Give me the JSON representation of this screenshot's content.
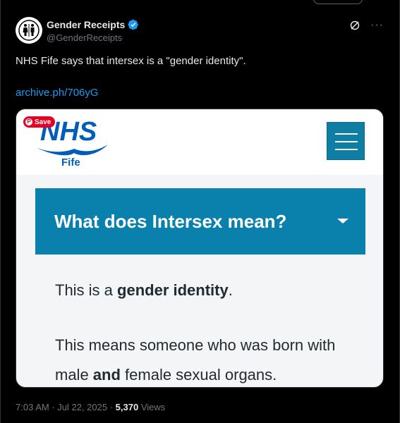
{
  "author": {
    "name": "Gender Receipts",
    "handle": "@GenderReceipts"
  },
  "post": {
    "text": "NHS Fife says that intersex is a \"gender identity\".",
    "link": "archive.ph/706yG"
  },
  "card": {
    "save_label": "Save",
    "logo_text": "NHS",
    "logo_sub": "Fife",
    "heading": "What does Intersex mean?",
    "p1_pre": "This is a ",
    "p1_bold": "gender identity",
    "p1_post": ".",
    "p2_pre": "This means someone who was born with male ",
    "p2_bold": "and",
    "p2_post": " female sexual organs."
  },
  "meta": {
    "time": "7:03 AM",
    "sep1": " · ",
    "date": "Jul 22, 2025",
    "sep2": " · ",
    "views_count": "5,370",
    "views_label": " Views"
  },
  "colors": {
    "nhs_blue": "#005EB8",
    "accordion_blue": "#0A80AC",
    "link_blue": "#1D9BF0",
    "save_red": "#E60023"
  }
}
